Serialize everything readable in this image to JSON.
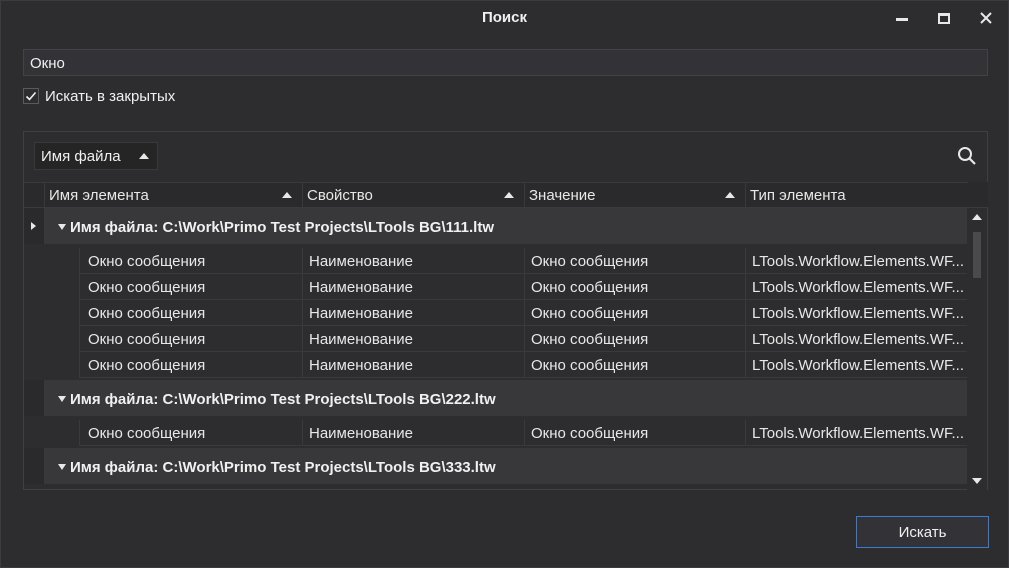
{
  "window": {
    "title": "Поиск"
  },
  "search": {
    "value": "Окно"
  },
  "options": {
    "search_closed_label": "Искать в закрытых",
    "search_closed_checked": true
  },
  "grouping": {
    "chip_label": "Имя файла"
  },
  "columns": [
    "Имя элемента",
    "Свойство",
    "Значение",
    "Тип элемента"
  ],
  "groups": [
    {
      "label": "Имя файла: C:\\Work\\Primo Test Projects\\LTools BG\\111.ltw",
      "rows": [
        [
          "Окно сообщения",
          "Наименование",
          "Окно сообщения",
          "LTools.Workflow.Elements.WF..."
        ],
        [
          "Окно сообщения",
          "Наименование",
          "Окно сообщения",
          "LTools.Workflow.Elements.WF..."
        ],
        [
          "Окно сообщения",
          "Наименование",
          "Окно сообщения",
          "LTools.Workflow.Elements.WF..."
        ],
        [
          "Окно сообщения",
          "Наименование",
          "Окно сообщения",
          "LTools.Workflow.Elements.WF..."
        ],
        [
          "Окно сообщения",
          "Наименование",
          "Окно сообщения",
          "LTools.Workflow.Elements.WF..."
        ]
      ]
    },
    {
      "label": "Имя файла: C:\\Work\\Primo Test Projects\\LTools BG\\222.ltw",
      "rows": [
        [
          "Окно сообщения",
          "Наименование",
          "Окно сообщения",
          "LTools.Workflow.Elements.WF..."
        ]
      ]
    },
    {
      "label": "Имя файла: C:\\Work\\Primo Test Projects\\LTools BG\\333.ltw",
      "rows": []
    }
  ],
  "buttons": {
    "search_label": "Искать"
  },
  "icons": {
    "minimize": "minimize-icon",
    "maximize": "maximize-icon",
    "close": "close-icon",
    "search": "search-icon"
  },
  "colors": {
    "background": "#2d2d30",
    "accent": "#3a7bd5",
    "group_row": "#38383b"
  }
}
